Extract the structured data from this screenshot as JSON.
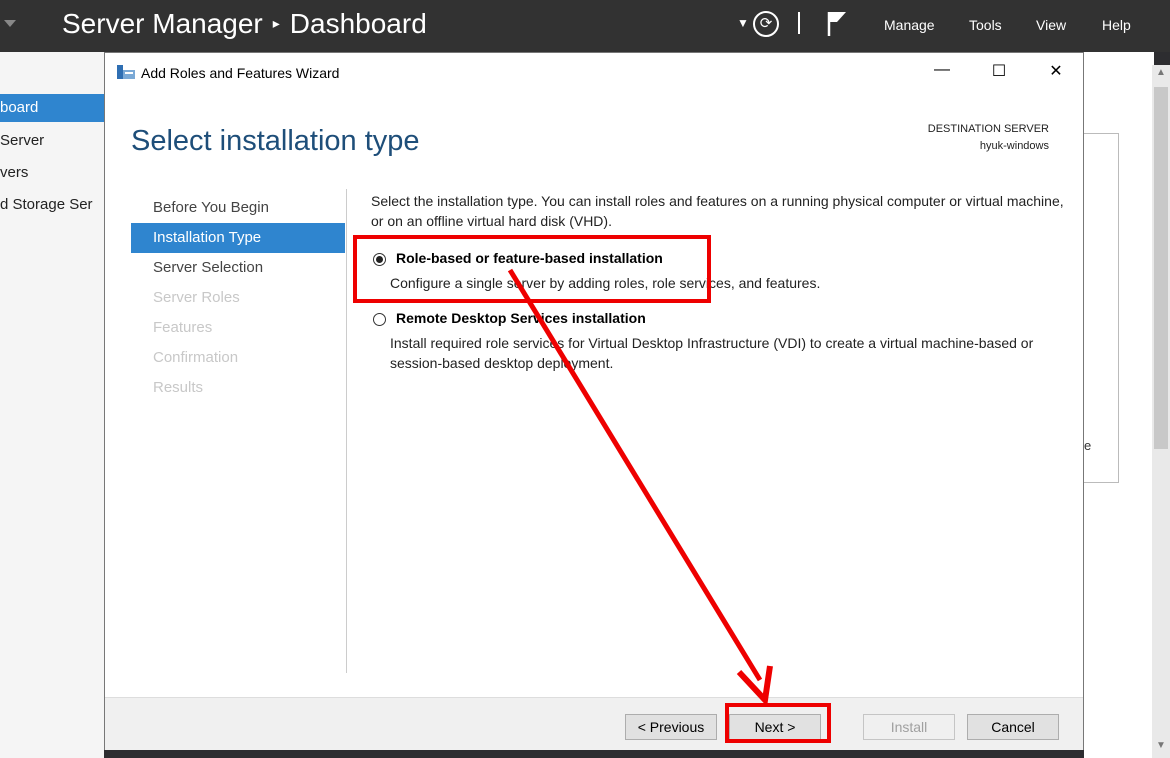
{
  "server_manager": {
    "title": "Server Manager",
    "separator": "▸",
    "section": "Dashboard",
    "menu": [
      "Manage",
      "Tools",
      "View",
      "Help"
    ],
    "sidebar": [
      "board",
      "Server",
      "vers",
      "d Storage Ser"
    ],
    "panel_text": "e"
  },
  "wizard": {
    "window_title": "Add Roles and Features Wizard",
    "controls": {
      "minimize": "—",
      "maximize": "☐",
      "close": "✕"
    },
    "page_title": "Select installation type",
    "destination_label": "DESTINATION SERVER",
    "destination_name": "hyuk-windows",
    "steps": [
      {
        "label": "Before You Begin",
        "state": "normal"
      },
      {
        "label": "Installation Type",
        "state": "active"
      },
      {
        "label": "Server Selection",
        "state": "normal"
      },
      {
        "label": "Server Roles",
        "state": "disabled"
      },
      {
        "label": "Features",
        "state": "disabled"
      },
      {
        "label": "Confirmation",
        "state": "disabled"
      },
      {
        "label": "Results",
        "state": "disabled"
      }
    ],
    "intro": "Select the installation type. You can install roles and features on a running physical computer or virtual machine, or on an offline virtual hard disk (VHD).",
    "options": [
      {
        "title": "Role-based or feature-based installation",
        "description": "Configure a single server by adding roles, role services, and features.",
        "selected": true
      },
      {
        "title": "Remote Desktop Services installation",
        "description": "Install required role services for Virtual Desktop Infrastructure (VDI) to create a virtual machine-based or session-based desktop deployment.",
        "selected": false
      }
    ],
    "buttons": {
      "previous": "< Previous",
      "next": "Next >",
      "install": "Install",
      "cancel": "Cancel"
    }
  },
  "annotation_color": "#ee0000"
}
